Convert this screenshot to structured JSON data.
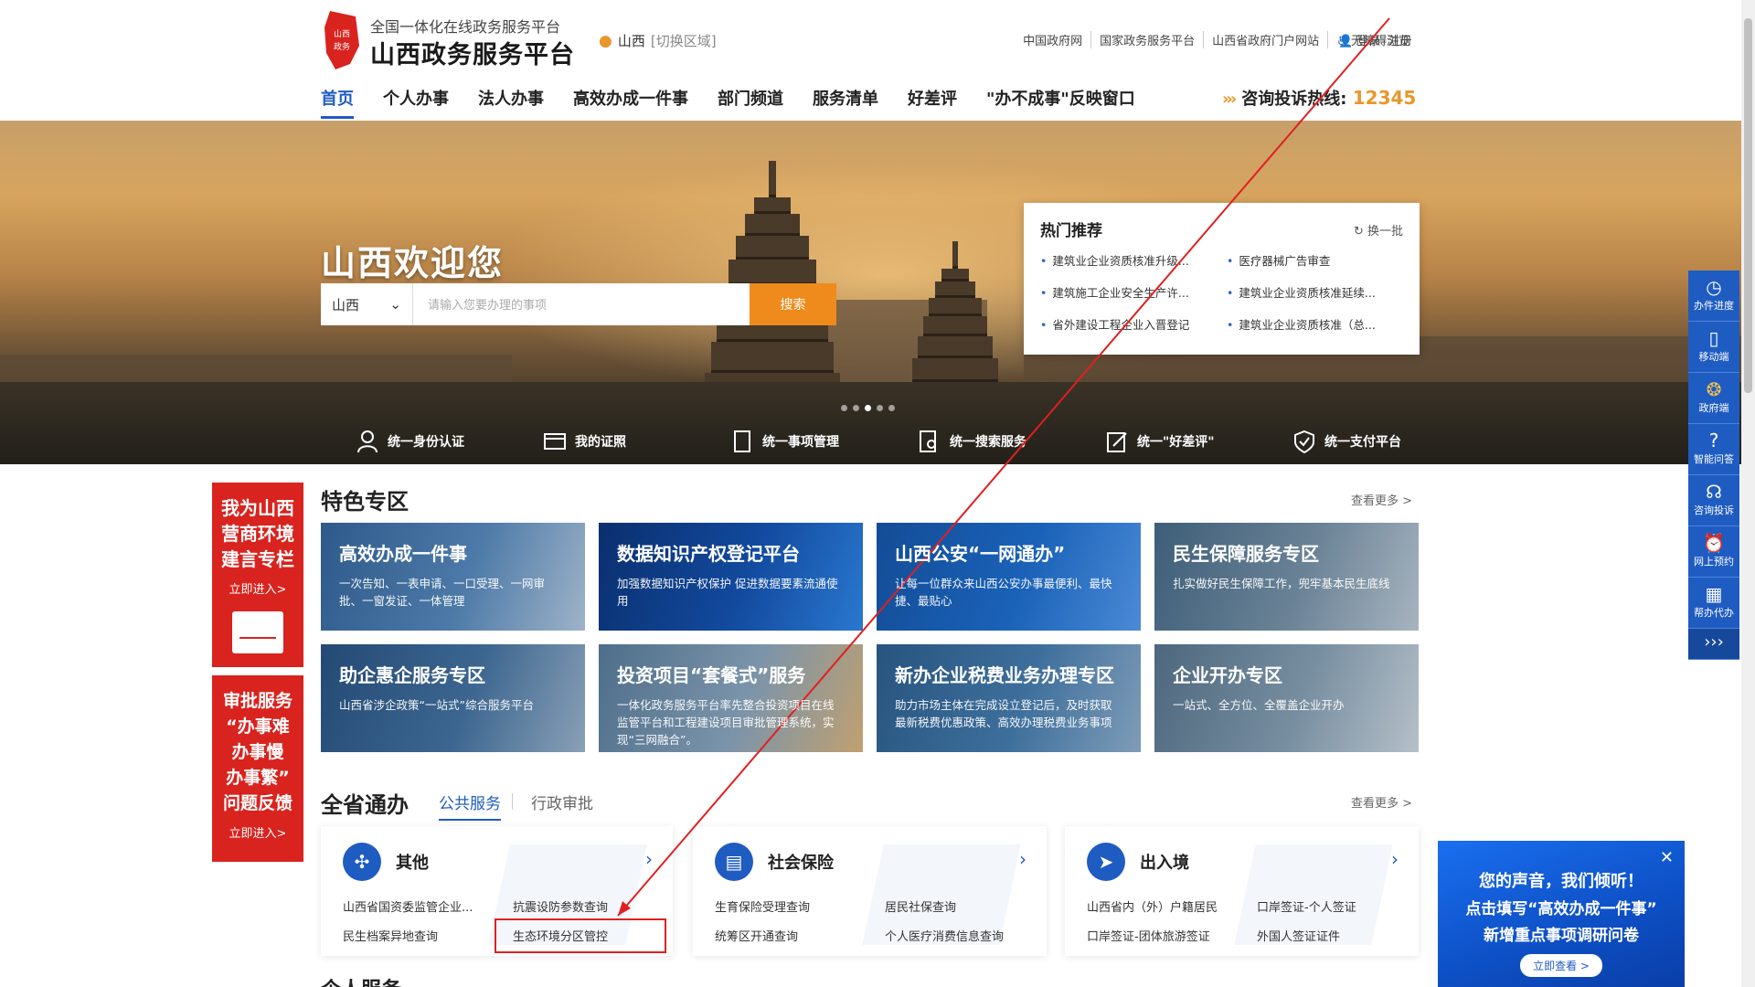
{
  "header": {
    "logo_sub": "全国一体化在线政务服务平台",
    "logo_main": "山西政务服务平台",
    "region": "山西",
    "region_switch": "[切换区域]",
    "top_links": [
      "中国政府网",
      "国家政务服务平台",
      "山西省政府门户网站",
      "无障碍浏览"
    ],
    "login": "登录",
    "register": "注册"
  },
  "nav": {
    "items": [
      "首页",
      "个人办事",
      "法人办事",
      "高效办成一件事",
      "部门频道",
      "服务清单",
      "好差评",
      "\"办不成事\"反映窗口"
    ],
    "hotline_label": "咨询投诉热线:",
    "hotline_number": "12345"
  },
  "banner": {
    "title": "山西欢迎您",
    "search_region": "山西",
    "search_placeholder": "请输入您要办理的事项",
    "search_button": "搜索",
    "hot": {
      "title": "热门推荐",
      "refresh": "换一批",
      "items": [
        "建筑业企业资质核准升级...",
        "医疗器械广告审查",
        "建筑施工企业安全生产许...",
        "建筑业企业资质核准延续...",
        "省外建设工程企业入晋登记",
        "建筑业企业资质核准（总..."
      ]
    },
    "quick": [
      "统一身份认证",
      "我的证照",
      "统一事项管理",
      "统一搜索服务",
      "统一\"好差评\"",
      "统一支付平台"
    ]
  },
  "left_panels": [
    {
      "title_lines": [
        "我为山西",
        "营商环境",
        "建言专栏"
      ],
      "link": "立即进入>"
    },
    {
      "title_lines": [
        "审批服务",
        "“办事难",
        "办事慢",
        "办事繁”",
        "问题反馈"
      ],
      "link": "立即进入>"
    }
  ],
  "special": {
    "title": "特色专区",
    "more": "查看更多 >",
    "cards": [
      {
        "title": "高效办成一件事",
        "desc": "一次告知、一表申请、一口受理、一网审批、一窗发证、一体管理",
        "color": "#2d5a8a"
      },
      {
        "title": "数据知识产权登记平台",
        "desc": "加强数据知识产权保护 促进数据要素流通使用",
        "color": "#0d3f8a"
      },
      {
        "title": "山西公安“一网通办”",
        "desc": "让每一位群众来山西公安办事最便利、最快捷、最贴心",
        "color": "#1a5fb0"
      },
      {
        "title": "民生保障服务专区",
        "desc": "扎实做好民生保障工作，兜牢基本民生底线",
        "color": "#4a6a82"
      },
      {
        "title": "助企惠企服务专区",
        "desc": "山西省涉企政策“一站式”综合服务平台",
        "color": "#2a4f78"
      },
      {
        "title": "投资项目“套餐式”服务",
        "desc": "一体化政务服务平台率先整合投资项目在线监管平台和工程建设项目审批管理系统，实现“三网融合”。",
        "color": "#5c7a94"
      },
      {
        "title": "新办企业税费业务办理专区",
        "desc": "助力市场主体在完成设立登记后，及时获取最新税费优惠政策、高效办理税费业务事项",
        "color": "#2f5f8c"
      },
      {
        "title": "企业开办专区",
        "desc": "一站式、全方位、全覆盖企业开办",
        "color": "#5a7288"
      }
    ]
  },
  "province": {
    "title": "全省通办",
    "tabs": [
      "公共服务",
      "行政审批"
    ],
    "more": "查看更多 >",
    "services": [
      {
        "name": "其他",
        "icon": "grid-icon",
        "items": [
          "山西省国资委监管企业...",
          "抗震设防参数查询",
          "民生档案异地查询",
          "生态环境分区管控"
        ]
      },
      {
        "name": "社会保险",
        "icon": "document-icon",
        "items": [
          "生育保险受理查询",
          "居民社保查询",
          "统筹区开通查询",
          "个人医疗消费信息查询"
        ]
      },
      {
        "name": "出入境",
        "icon": "paper-plane-icon",
        "items": [
          "山西省内（外）户籍居民",
          "口岸签证-个人签证",
          "口岸签证-团体旅游签证",
          "外国人签证证件"
        ]
      }
    ]
  },
  "personal_section": "个人服务",
  "popup": {
    "line1": "您的声音，我们倾听！",
    "line2": "点击填写“高效办成一件事”",
    "line3": "新增重点事项调研问卷",
    "button": "立即查看 >"
  },
  "float_bar": [
    "办件进度",
    "移动端",
    "政府端",
    "智能问答",
    "咨询投诉",
    "网上预约",
    "帮办代办"
  ],
  "colors": {
    "brand_blue": "#1f5cc2",
    "accent_orange": "#ef8b1c",
    "red": "#d9231e"
  }
}
